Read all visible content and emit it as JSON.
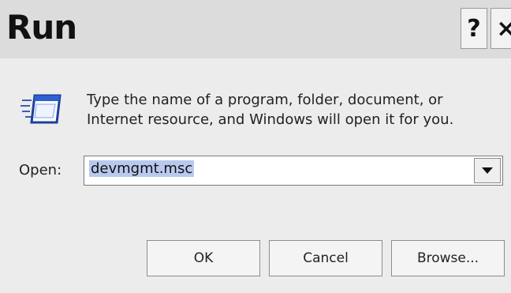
{
  "window": {
    "title": "Run",
    "help_button": "?",
    "close_button": "×"
  },
  "prompt": {
    "line1": "Type the name of a program, folder, document, or",
    "line2": "Internet resource, and Windows will open it for you."
  },
  "open_field": {
    "label": "Open:",
    "value": "devmgmt.msc"
  },
  "buttons": {
    "ok": "OK",
    "cancel": "Cancel",
    "browse": "Browse..."
  },
  "icons": {
    "run": "run-window-icon",
    "dropdown": "chevron-down-icon"
  },
  "colors": {
    "titlebar": "#dcdcdc",
    "dialog_bg": "#ececec",
    "selection": "#b9c9ee"
  }
}
